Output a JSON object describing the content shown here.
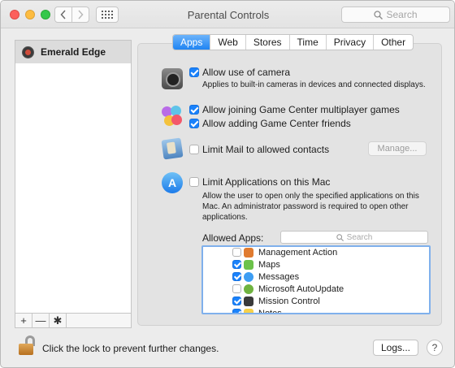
{
  "window": {
    "title": "Parental Controls"
  },
  "toolbar": {
    "search_placeholder": "Search"
  },
  "sidebar": {
    "users": [
      {
        "name": "Emerald Edge"
      }
    ],
    "tools": [
      "+",
      "—",
      "✱"
    ]
  },
  "tabs": [
    {
      "label": "Apps",
      "active": true
    },
    {
      "label": "Web"
    },
    {
      "label": "Stores"
    },
    {
      "label": "Time"
    },
    {
      "label": "Privacy"
    },
    {
      "label": "Other"
    }
  ],
  "options": {
    "camera": {
      "label": "Allow use of camera",
      "checked": true,
      "description": "Applies to built-in cameras in devices and connected displays."
    },
    "gc_multiplayer": {
      "label": "Allow joining Game Center multiplayer games",
      "checked": true
    },
    "gc_friends": {
      "label": "Allow adding Game Center friends",
      "checked": true
    },
    "mail": {
      "label": "Limit Mail to allowed contacts",
      "checked": false,
      "button": "Manage..."
    },
    "apps_limit": {
      "label": "Limit Applications on this Mac",
      "checked": false,
      "description_lines": [
        "Allow the user to open only the specified applications on this",
        "Mac. An administrator password is required to open other",
        "applications."
      ]
    }
  },
  "allowed_apps": {
    "label": "Allowed Apps:",
    "search_placeholder": "Search",
    "items": [
      {
        "name": "Management Action",
        "checked": false,
        "icon": "management-action-icon",
        "color": "#e07b2f"
      },
      {
        "name": "Maps",
        "checked": true,
        "icon": "maps-icon",
        "color": "#6cc24a"
      },
      {
        "name": "Messages",
        "checked": true,
        "icon": "messages-icon",
        "color": "#3d9df3"
      },
      {
        "name": "Microsoft AutoUpdate",
        "checked": false,
        "icon": "microsoft-autoupdate-icon",
        "color": "#6fb33f"
      },
      {
        "name": "Mission Control",
        "checked": true,
        "icon": "mission-control-icon",
        "color": "#3a3a3a"
      },
      {
        "name": "Notes",
        "checked": true,
        "icon": "notes-icon",
        "color": "#f5d04a"
      }
    ]
  },
  "footer": {
    "lock_text": "Click the lock to prevent further changes.",
    "logs_button": "Logs...",
    "help_button": "?"
  }
}
